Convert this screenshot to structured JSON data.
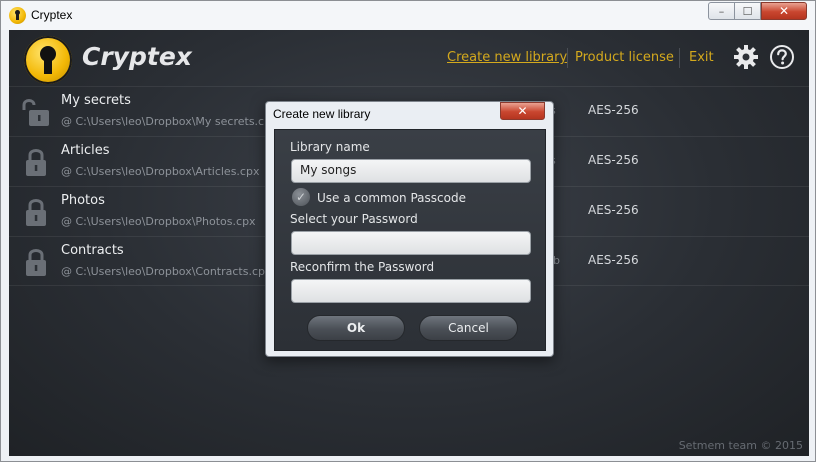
{
  "window": {
    "title": "Cryptex",
    "minimize_glyph": "–",
    "maximize_glyph": "☐",
    "close_glyph": "✕"
  },
  "header": {
    "brand": "Cryptex",
    "nav": {
      "create": "Create new library",
      "license": "Product license",
      "exit": "Exit"
    },
    "icons": [
      "gear-icon",
      "help-icon"
    ]
  },
  "libraries": [
    {
      "name": "My secrets",
      "path": "@ C:\\Users\\leo\\Dropbox\\My secrets.cpx",
      "cipher": "AES-256",
      "fragment": "s",
      "locked": false
    },
    {
      "name": "Articles",
      "path": "@ C:\\Users\\leo\\Dropbox\\Articles.cpx",
      "cipher": "AES-256",
      "fragment": "s",
      "locked": true
    },
    {
      "name": "Photos",
      "path": "@ C:\\Users\\leo\\Dropbox\\Photos.cpx",
      "cipher": "AES-256",
      "fragment": "",
      "locked": true
    },
    {
      "name": "Contracts",
      "path": "@ C:\\Users\\leo\\Dropbox\\Contracts.cpx",
      "cipher": "AES-256",
      "fragment": "lb",
      "locked": true
    }
  ],
  "footer": "Setmem team © 2015",
  "dialog": {
    "title": "Create new library",
    "close_glyph": "✕",
    "library_name_label": "Library name",
    "library_name_value": "My songs",
    "common_passcode_label": "Use a common Passcode",
    "common_passcode_checked": true,
    "check_glyph": "✓",
    "password_label": "Select your Password",
    "password_value": "",
    "reconfirm_label": "Reconfirm the Password",
    "reconfirm_value": "",
    "ok_label": "Ok",
    "cancel_label": "Cancel"
  },
  "colors": {
    "accent": "#d4a91d",
    "background": "#2a2e34",
    "close_red": "#c9462f"
  }
}
